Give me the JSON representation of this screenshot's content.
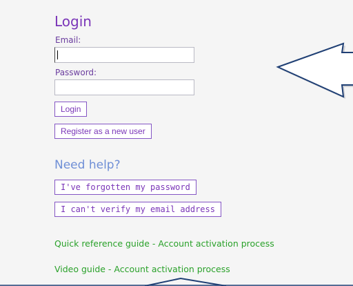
{
  "login": {
    "title": "Login",
    "email_label": "Email:",
    "email_value": "",
    "password_label": "Password:",
    "password_value": "",
    "login_button": "Login",
    "register_button": "Register as a new user"
  },
  "help": {
    "title": "Need help?",
    "forgot_button": "I've forgotten my password",
    "verify_button": "I can't verify my email address"
  },
  "guides": {
    "quick_reference": "Quick reference guide - Account activation process",
    "video": "Video guide - Account activation process"
  },
  "colors": {
    "accent": "#7a35b8",
    "help_title": "#6f8fd6",
    "link": "#2aa12a",
    "arrow": "#1f3f74"
  }
}
